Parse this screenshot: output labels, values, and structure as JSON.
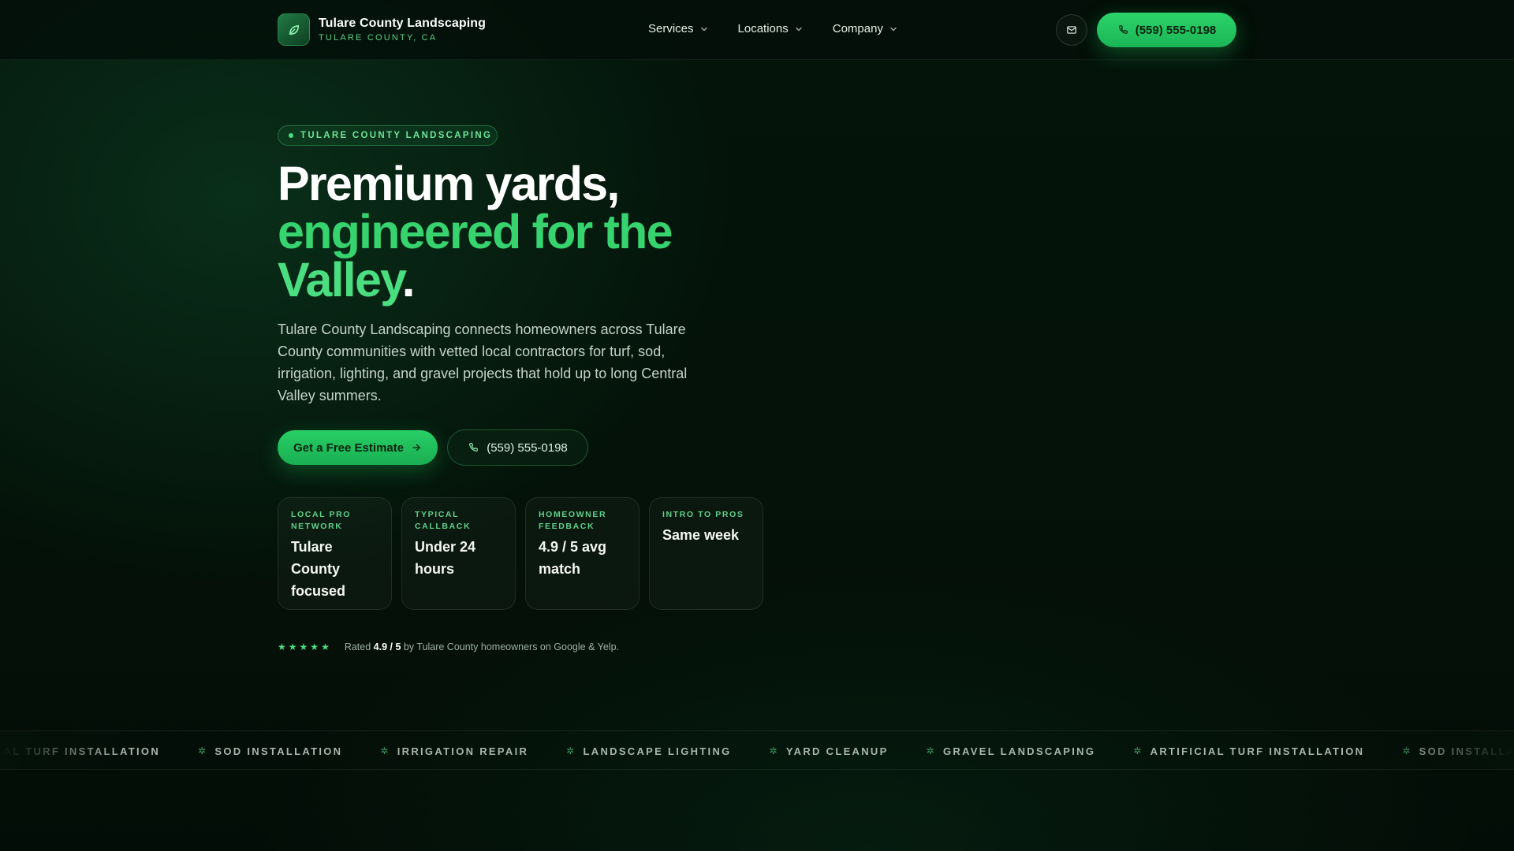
{
  "brand": {
    "name": "Tulare County Landscaping",
    "sub": "TULARE COUNTY, CA"
  },
  "nav": {
    "items": [
      {
        "label": "Services"
      },
      {
        "label": "Locations"
      },
      {
        "label": "Company"
      }
    ]
  },
  "header": {
    "phone_label": "(559) 555-0198",
    "mail_icon": "mail-icon"
  },
  "hero": {
    "eyebrow": "TULARE COUNTY LANDSCAPING",
    "headline_line1": "Premium yards,",
    "headline_line2": "engineered for the",
    "headline_line3": "Valley",
    "headline_period": ".",
    "lead": "Tulare County Landscaping connects homeowners across Tulare County communities with vetted local contractors for turf, sod, irrigation, lighting, and gravel projects that hold up to long Central Valley summers.",
    "cta_primary": "Get a Free Estimate",
    "cta_secondary": "(559) 555-0198"
  },
  "stats": [
    {
      "label": "LOCAL PRO NETWORK",
      "value": "Tulare County focused"
    },
    {
      "label": "TYPICAL CALLBACK",
      "value": "Under 24 hours"
    },
    {
      "label": "HOMEOWNER FEEDBACK",
      "value": "4.9 / 5 avg match"
    },
    {
      "label": "INTRO TO PROS",
      "value": "Same week"
    }
  ],
  "rating": {
    "stars": 5,
    "prefix": "Rated",
    "score": "4.9 / 5",
    "suffix": "by Tulare County homeowners on Google & Yelp."
  },
  "marquee": [
    "ARTIFICIAL TURF INSTALLATION",
    "SOD INSTALLATION",
    "IRRIGATION REPAIR",
    "LANDSCAPE LIGHTING",
    "YARD CLEANUP",
    "GRAVEL LANDSCAPING",
    "ARTIFICIAL TURF INSTALLATION",
    "SOD INSTALLATION"
  ],
  "colors": {
    "accent": "#22c55e",
    "accent_light": "#4ade80",
    "background": "#041209"
  }
}
